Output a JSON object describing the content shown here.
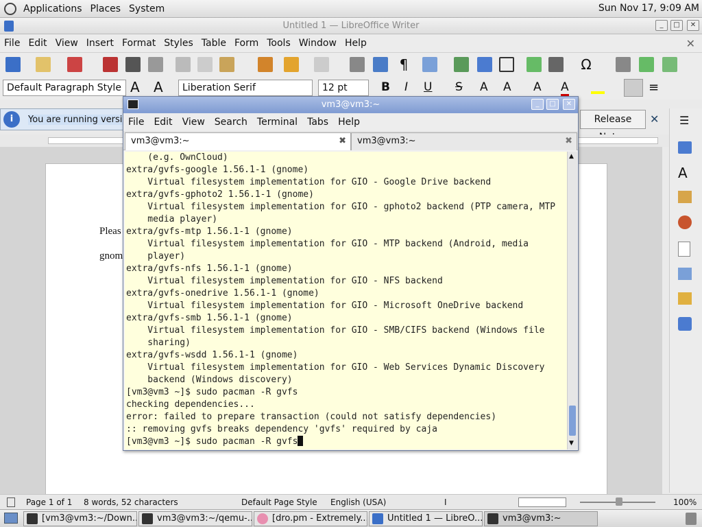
{
  "panel": {
    "menus": [
      "Applications",
      "Places",
      "System"
    ],
    "clock": "Sun Nov 17,  9:09 AM"
  },
  "writer": {
    "title": "Untitled 1 — LibreOffice Writer",
    "menus": [
      "File",
      "Edit",
      "View",
      "Insert",
      "Format",
      "Styles",
      "Table",
      "Form",
      "Tools",
      "Window",
      "Help"
    ],
    "paragraph_style": "Default Paragraph Style",
    "font_name": "Liberation Serif",
    "font_size": "12 pt",
    "infobar_text": "You are running versio",
    "release_notes": "Release Notes",
    "doc_line1": "Pleas",
    "doc_line2": "gnom",
    "status": {
      "page": "Page 1 of 1",
      "words": "8 words, 52 characters",
      "page_style": "Default Page Style",
      "language": "English (USA)",
      "zoom": "100%"
    }
  },
  "terminal": {
    "title": "vm3@vm3:~",
    "menus": [
      "File",
      "Edit",
      "View",
      "Search",
      "Terminal",
      "Tabs",
      "Help"
    ],
    "tabs": [
      "vm3@vm3:~",
      "vm3@vm3:~"
    ],
    "lines": [
      "    (e.g. OwnCloud)",
      "extra/gvfs-google 1.56.1-1 (gnome)",
      "    Virtual filesystem implementation for GIO - Google Drive backend",
      "extra/gvfs-gphoto2 1.56.1-1 (gnome)",
      "    Virtual filesystem implementation for GIO - gphoto2 backend (PTP camera, MTP",
      "    media player)",
      "extra/gvfs-mtp 1.56.1-1 (gnome)",
      "    Virtual filesystem implementation for GIO - MTP backend (Android, media",
      "    player)",
      "extra/gvfs-nfs 1.56.1-1 (gnome)",
      "    Virtual filesystem implementation for GIO - NFS backend",
      "extra/gvfs-onedrive 1.56.1-1 (gnome)",
      "    Virtual filesystem implementation for GIO - Microsoft OneDrive backend",
      "extra/gvfs-smb 1.56.1-1 (gnome)",
      "    Virtual filesystem implementation for GIO - SMB/CIFS backend (Windows file",
      "    sharing)",
      "extra/gvfs-wsdd 1.56.1-1 (gnome)",
      "    Virtual filesystem implementation for GIO - Web Services Dynamic Discovery",
      "    backend (Windows discovery)",
      "[vm3@vm3 ~]$ sudo pacman -R gvfs",
      "checking dependencies...",
      "error: failed to prepare transaction (could not satisfy dependencies)",
      ":: removing gvfs breaks dependency 'gvfs' required by caja"
    ],
    "prompt_line": "[vm3@vm3 ~]$ sudo pacman -R gvfs"
  },
  "taskbar": [
    "[vm3@vm3:~/Down...",
    "vm3@vm3:~/qemu-...",
    "[dro.pm - Extremely...",
    "Untitled 1 — LibreO...",
    "vm3@vm3:~"
  ],
  "colors": {
    "terminal_bg": "#ffffdd",
    "title_active": "#7f9bd2"
  }
}
